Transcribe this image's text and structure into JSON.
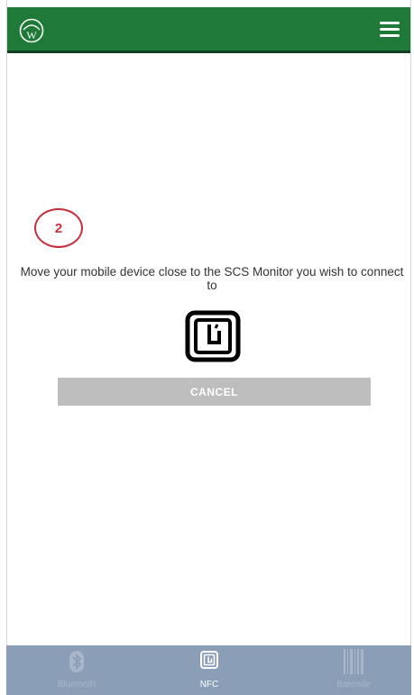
{
  "header": {
    "logo_icon": "w-logo-icon",
    "menu_icon": "hamburger-menu-icon",
    "bg_color": "#1f7a37"
  },
  "main": {
    "step_number": "2",
    "instruction": "Move your mobile device close to the SCS Monitor you wish to connect to",
    "nfc_icon": "nfc-icon",
    "cancel_label": "CANCEL"
  },
  "bottom_nav": {
    "tabs": [
      {
        "label": "Bluetooth",
        "icon": "bluetooth-icon",
        "active": false
      },
      {
        "label": "NFC",
        "icon": "nfc-icon",
        "active": true
      },
      {
        "label": "Barcode",
        "icon": "barcode-icon",
        "active": false
      }
    ]
  },
  "colors": {
    "accent_red": "#c62f3b",
    "nav_bg": "#8a9fb7",
    "button_bg": "#bebebe"
  }
}
